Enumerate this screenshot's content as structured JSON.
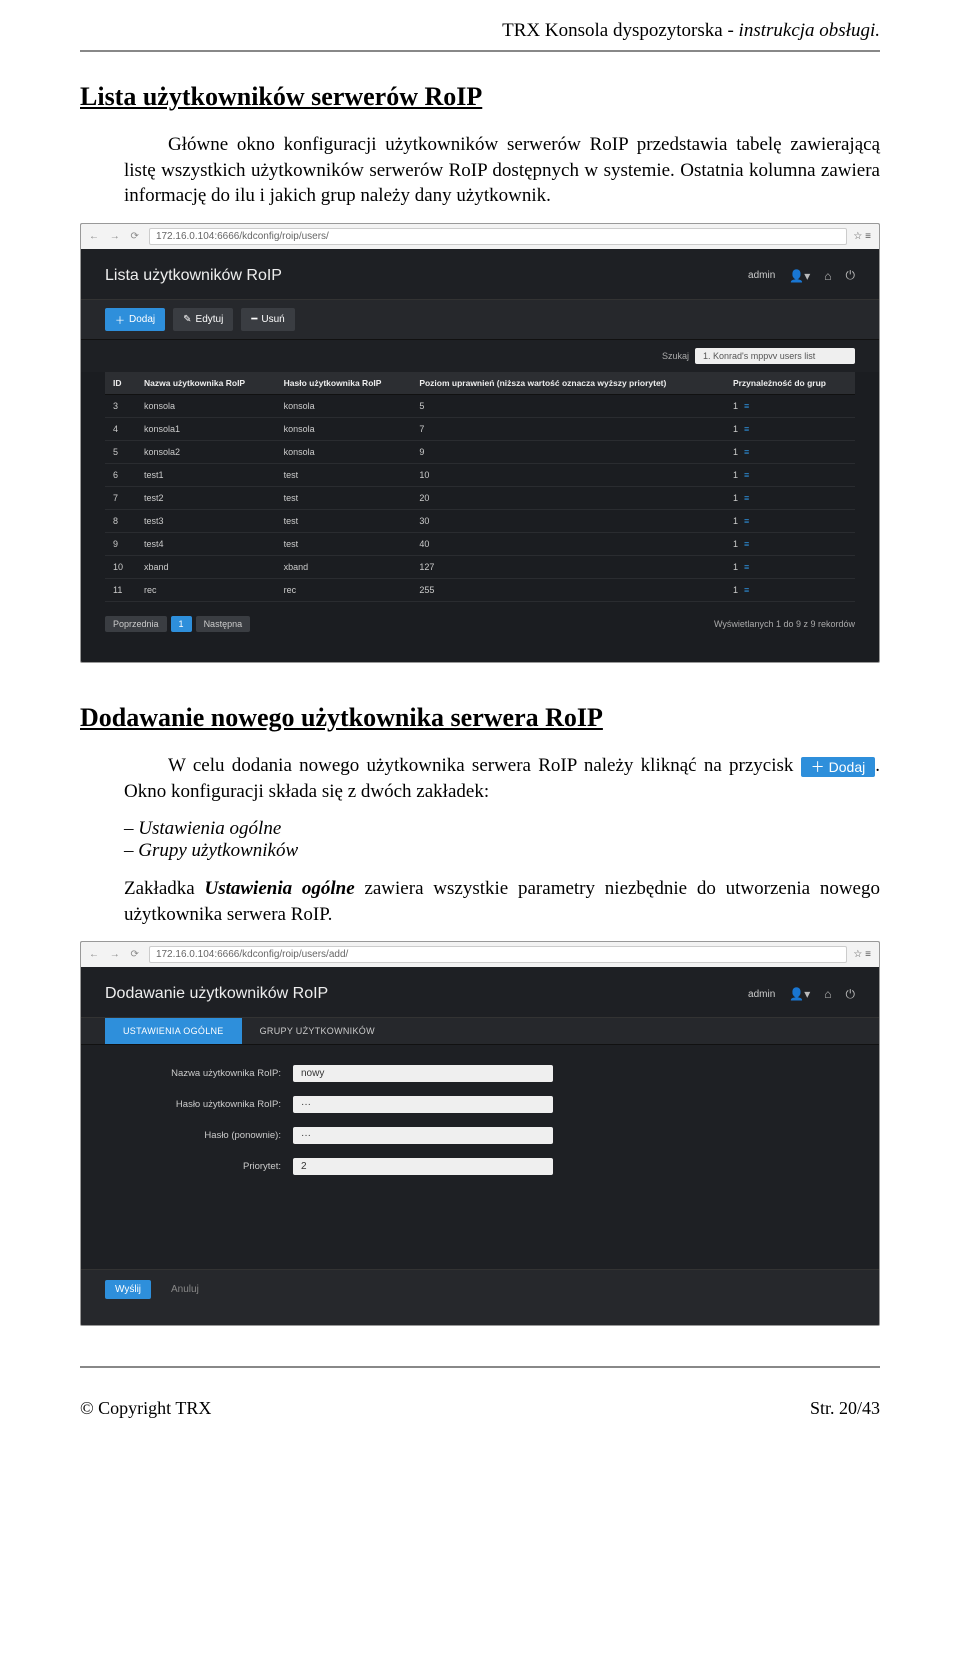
{
  "doc": {
    "header_title": "TRX Konsola dyspozytorska - ",
    "header_title_em": "instrukcja obsługi.",
    "copyright": "© Copyright TRX",
    "page_num": "Str. 20/43"
  },
  "section1": {
    "heading": "Lista użytkowników serwerów RoIP",
    "para1": "Główne okno konfiguracji użytkowników serwerów RoIP przedstawia tabelę zawierającą listę wszystkich użytkowników serwerów RoIP dostępnych w systemie. Ostatnia kolumna zawiera informację do ilu i jakich grup należy dany użytkownik."
  },
  "shot1": {
    "url": "172.16.0.104:6666/kdconfig/roip/users/",
    "title": "Lista użytkowników RoIP",
    "admin": "admin",
    "add_label": "Dodaj",
    "edit_label": "Edytuj",
    "delete_label": "Usuń",
    "search_label": "Szukaj",
    "search_placeholder": "1. Konrad's mppvv users list",
    "cols": {
      "id": "ID",
      "name": "Nazwa użytkownika RoIP",
      "pass": "Hasło użytkownika RoIP",
      "priv": "Poziom uprawnień (niższa wartość oznacza wyższy priorytet)",
      "groups": "Przynależność do grup"
    },
    "rows": [
      {
        "id": "3",
        "name": "konsola",
        "pass": "konsola",
        "priv": "5",
        "groups": "1"
      },
      {
        "id": "4",
        "name": "konsola1",
        "pass": "konsola",
        "priv": "7",
        "groups": "1"
      },
      {
        "id": "5",
        "name": "konsola2",
        "pass": "konsola",
        "priv": "9",
        "groups": "1"
      },
      {
        "id": "6",
        "name": "test1",
        "pass": "test",
        "priv": "10",
        "groups": "1"
      },
      {
        "id": "7",
        "name": "test2",
        "pass": "test",
        "priv": "20",
        "groups": "1"
      },
      {
        "id": "8",
        "name": "test3",
        "pass": "test",
        "priv": "30",
        "groups": "1"
      },
      {
        "id": "9",
        "name": "test4",
        "pass": "test",
        "priv": "40",
        "groups": "1"
      },
      {
        "id": "10",
        "name": "xband",
        "pass": "xband",
        "priv": "127",
        "groups": "1"
      },
      {
        "id": "11",
        "name": "rec",
        "pass": "rec",
        "priv": "255",
        "groups": "1"
      }
    ],
    "prev": "Poprzednia",
    "page": "1",
    "next": "Następna",
    "summary": "Wyświetlanych 1 do 9 z 9 rekordów"
  },
  "section2": {
    "heading": "Dodawanie nowego użytkownika serwera RoIP",
    "para1a": "W celu dodania nowego użytkownika serwera RoIP należy kliknąć na przycisk ",
    "btn_label": "Dodaj",
    "para1b": ". Okno konfiguracji składa się z dwóch zakładek:",
    "li1": "Ustawienia ogólne",
    "li2": "Grupy użytkowników",
    "para2a": "Zakładka ",
    "para2b": "Ustawienia ogólne",
    "para2c": " zawiera wszystkie parametry niezbędnie do utworzenia nowego użytkownika serwera RoIP."
  },
  "shot2": {
    "url": "172.16.0.104:6666/kdconfig/roip/users/add/",
    "title": "Dodawanie użytkowników RoIP",
    "admin": "admin",
    "tab1": "USTAWIENIA OGÓLNE",
    "tab2": "GRUPY UŻYTKOWNIKÓW",
    "fields": {
      "name_lbl": "Nazwa użytkownika RoIP:",
      "name_val": "nowy",
      "pass_lbl": "Hasło użytkownika RoIP:",
      "pass_val": "···",
      "pass2_lbl": "Hasło (ponownie):",
      "pass2_val": "···",
      "prio_lbl": "Priorytet:",
      "prio_val": "2"
    },
    "send": "Wyślij",
    "cancel": "Anuluj"
  }
}
